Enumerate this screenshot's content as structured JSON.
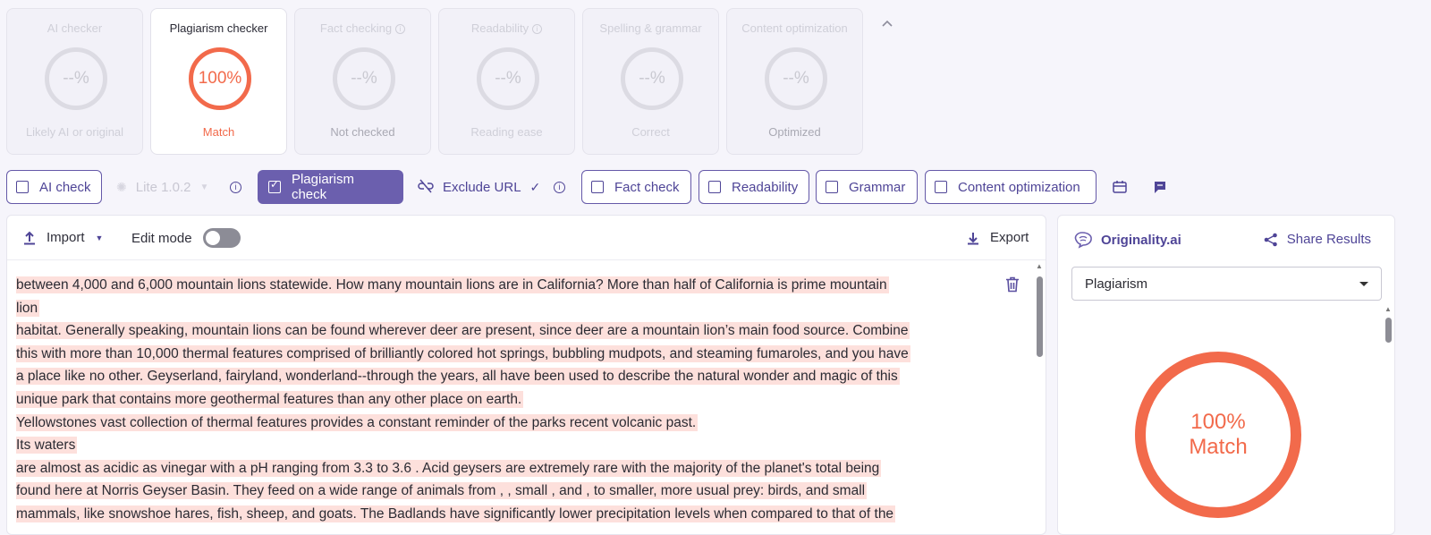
{
  "cards": [
    {
      "title": "AI checker",
      "info": false,
      "value": "--%",
      "sub": "Likely AI or original",
      "state": "disabled"
    },
    {
      "title": "Plagiarism checker",
      "info": false,
      "value": "100%",
      "sub": "Match",
      "state": "active"
    },
    {
      "title": "Fact checking",
      "info": true,
      "value": "--%",
      "sub": "Not checked",
      "state": "notch"
    },
    {
      "title": "Readability",
      "info": true,
      "value": "--%",
      "sub": "Reading ease",
      "state": "disabled"
    },
    {
      "title": "Spelling & grammar",
      "info": false,
      "value": "--%",
      "sub": "Correct",
      "state": "disabled"
    },
    {
      "title": "Content optimization",
      "info": false,
      "value": "--%",
      "sub": "Optimized",
      "state": "notch"
    }
  ],
  "toolbar": {
    "ai_check": "AI check",
    "model": "Lite 1.0.2",
    "plagiarism_check": "Plagiarism check",
    "exclude_url": "Exclude URL",
    "fact_check": "Fact check",
    "readability": "Readability",
    "grammar": "Grammar",
    "content_optimization": "Content optimization"
  },
  "editor": {
    "import_label": "Import",
    "edit_mode_label": "Edit mode",
    "export_label": "Export",
    "lines": [
      "between 4,000 and 6,000 mountain lions statewide. How many mountain lions are in California? More than half of California is prime mountain",
      "lion",
      "habitat. Generally speaking, mountain lions can be found wherever deer are present, since deer are a mountain lion’s main food source. Combine",
      "this with more than 10,000 thermal features comprised of brilliantly colored hot springs, bubbling mudpots, and steaming fumaroles, and you have",
      "a place like no other. Geyserland, fairyland, wonderland--through the years, all have been used to describe the natural wonder and magic of this",
      "unique park that contains more geothermal features than any other place on earth.",
      "Yellowstones vast collection of thermal features provides a constant reminder of the parks recent volcanic past.",
      "Its waters",
      "are almost as acidic as vinegar with a pH ranging from 3.3 to 3.6 .  Acid geysers are extremely rare with the majority of the planet's total being",
      "found here at Norris Geyser Basin. They feed on a wide range of animals from , , small , and , to smaller, more usual prey: birds, and small",
      "mammals, like snowshoe hares, fish, sheep, and goats. The Badlands have significantly lower precipitation levels when compared to that of the"
    ]
  },
  "panel": {
    "brand": "Originality.ai",
    "share_label": "Share Results",
    "select_value": "Plagiarism",
    "score": "100%",
    "score_label": "Match"
  },
  "colors": {
    "accent": "#6b5fae",
    "match": "#f26a4b",
    "highlight": "#fde0dc"
  }
}
